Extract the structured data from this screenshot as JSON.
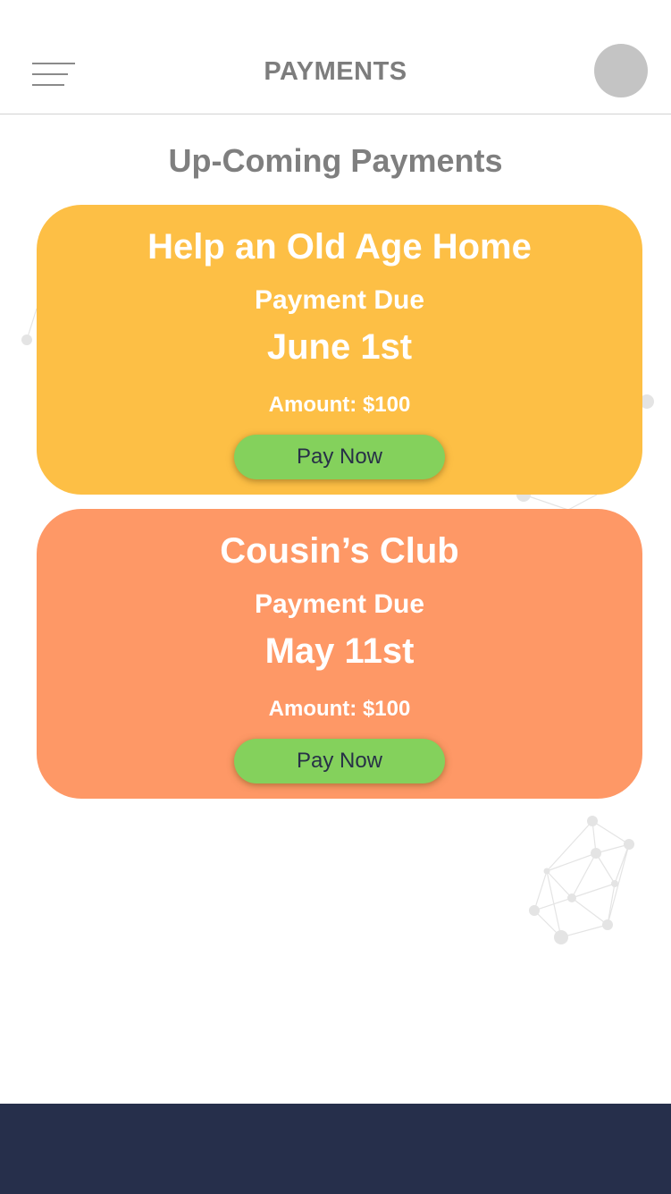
{
  "header": {
    "title": "PAYMENTS",
    "menu_icon": "hamburger-menu-icon",
    "avatar_color": "#c4c4c4"
  },
  "section": {
    "title": "Up-Coming Payments"
  },
  "payments": [
    {
      "name": "Help an Old Age Home",
      "due_label": "Payment Due",
      "due_date": "June 1st",
      "amount": "Amount: $100",
      "button_label": "Pay Now",
      "color": "#fdbf45"
    },
    {
      "name": "Cousin’s Club",
      "due_label": "Payment Due",
      "due_date": "May 11st",
      "amount": "Amount: $100",
      "button_label": "Pay Now",
      "color": "#fe9866"
    }
  ],
  "colors": {
    "button": "#84d15c",
    "button_text": "#273047",
    "footer": "#262f4b",
    "heading_text": "#7d7d7d"
  }
}
